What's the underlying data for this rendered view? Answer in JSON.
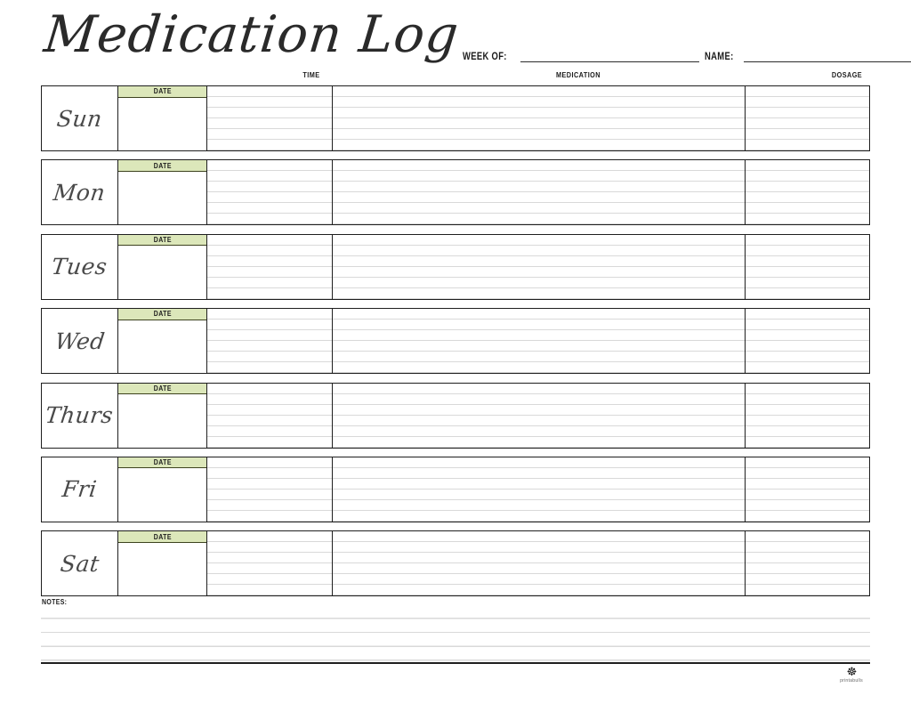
{
  "document": {
    "title": "Medication Log"
  },
  "header": {
    "fields": [
      {
        "label": "WEEK OF:",
        "value": "",
        "placeholder": ""
      },
      {
        "label": "NAME:",
        "value": "",
        "placeholder": ""
      }
    ]
  },
  "columns": {
    "time": "TIME",
    "medication": "MEDICATION",
    "dosage": "DOSAGE",
    "date": "DATE"
  },
  "days": [
    {
      "label": "Sun",
      "date": "",
      "time": "",
      "medication": "",
      "dosage": ""
    },
    {
      "label": "Mon",
      "date": "",
      "time": "",
      "medication": "",
      "dosage": ""
    },
    {
      "label": "Tues",
      "date": "",
      "time": "",
      "medication": "",
      "dosage": ""
    },
    {
      "label": "Wed",
      "date": "",
      "time": "",
      "medication": "",
      "dosage": ""
    },
    {
      "label": "Thurs",
      "date": "",
      "time": "",
      "medication": "",
      "dosage": ""
    },
    {
      "label": "Fri",
      "date": "",
      "time": "",
      "medication": "",
      "dosage": ""
    },
    {
      "label": "Sat",
      "date": "",
      "time": "",
      "medication": "",
      "dosage": ""
    }
  ],
  "notes": {
    "label": "NOTES:",
    "value": "",
    "line_count": 4
  },
  "footer": {
    "logo_mark": "☸",
    "logo_word": "printabulls"
  },
  "colors": {
    "date_band": "#dce7ba",
    "date_band_border": "#3d431f",
    "table_border": "#1f1f1f",
    "rule_line": "#d9d9d9",
    "text": "#1b1b1b",
    "script_text": "#4a4a4a",
    "page": "#ffffff"
  }
}
